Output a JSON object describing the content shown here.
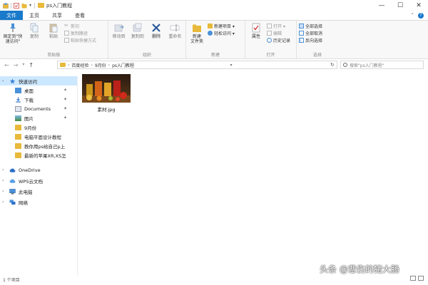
{
  "window": {
    "title": "ps入门教程",
    "controls": [
      "—",
      "☐",
      "✕"
    ]
  },
  "tabs": [
    {
      "label": "文件"
    },
    {
      "label": "主页"
    },
    {
      "label": "共享"
    },
    {
      "label": "查看"
    }
  ],
  "ribbon": {
    "clipboard": {
      "label": "剪贴板",
      "pin": "固定到\"快速访问\"",
      "copy": "复制",
      "paste": "粘贴",
      "cut": "剪切",
      "copy_path": "复制路径",
      "paste_shortcut": "粘贴快捷方式"
    },
    "organize": {
      "label": "组织",
      "move_to": "移动到",
      "copy_to": "复制到",
      "delete": "删除",
      "rename": "重命名"
    },
    "new": {
      "label": "新建",
      "new_folder": "新建\n文件夹",
      "new_item": "新建项目 ▾",
      "easy_access": "轻松访问 ▾"
    },
    "open": {
      "label": "打开",
      "properties": "属性",
      "open": "打开 ▾",
      "edit": "编辑",
      "history": "历史记录"
    },
    "select": {
      "label": "选择",
      "select_all": "全部选择",
      "select_none": "全部取消",
      "invert": "反向选择"
    }
  },
  "address": {
    "path": [
      "百度经验",
      "9月份",
      "ps入门教程"
    ],
    "search_placeholder": "搜索\"ps入门教程\""
  },
  "sidebar": {
    "items": [
      {
        "label": "快速访问",
        "selected": true
      },
      {
        "label": "桌面",
        "pinned": true
      },
      {
        "label": "下载",
        "pinned": true
      },
      {
        "label": "Documents",
        "pinned": true
      },
      {
        "label": "图片",
        "pinned": true
      },
      {
        "label": "9月份"
      },
      {
        "label": "电脑平面设计教程"
      },
      {
        "label": "教你用ps给自己p上"
      },
      {
        "label": "最新的苹果XR,XS怎"
      },
      {
        "label": "OneDrive"
      },
      {
        "label": "WPS云文档"
      },
      {
        "label": "此电脑"
      },
      {
        "label": "网络"
      }
    ]
  },
  "content": {
    "files": [
      {
        "name": "素材.jpg"
      }
    ]
  },
  "status": {
    "text": "1 个项目"
  },
  "watermark": "头条 @悲伤的猪大肠",
  "colors": {
    "accent": "#1979ca",
    "selection": "#cce8ff",
    "folder": "#e8b93a"
  }
}
